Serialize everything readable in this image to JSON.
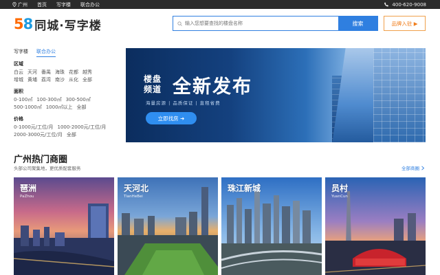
{
  "topbar": {
    "city": "广州",
    "links": [
      "首页",
      "写字楼",
      "联合办公"
    ],
    "phone": "400-620-9008"
  },
  "header": {
    "logo_number": "58",
    "logo_text": "同城·写字楼",
    "search_placeholder": "输入您想要查找的楼盘名称",
    "search_button": "搜索",
    "join_button": "品牌入驻 ▶"
  },
  "filters": {
    "tabs": [
      "写字楼",
      "联合办公"
    ],
    "active_tab": 1,
    "region": {
      "title": "区域",
      "rows": [
        [
          "白云",
          "天河",
          "番禺",
          "海珠",
          "花都",
          "越秀"
        ],
        [
          "增城",
          "黄埔",
          "荔湾",
          "南沙",
          "从化",
          "全部"
        ]
      ]
    },
    "area": {
      "title": "面积",
      "rows": [
        [
          "0-100㎡",
          "100-300㎡",
          "300-500㎡"
        ],
        [
          "500-1000㎡",
          "1000㎡以上",
          "全部"
        ]
      ]
    },
    "price": {
      "title": "价格",
      "rows": [
        [
          "0-1000元/工位/月",
          "1000-2000元/工位/月"
        ],
        [
          "2000-3000元/工位/月",
          "全部"
        ]
      ]
    }
  },
  "banner": {
    "label_line1": "楼盘",
    "label_line2": "频道",
    "headline": "全新发布",
    "tagline": "海量房源  |  品质保证  |  直租省费",
    "cta": "立即找房 ➜"
  },
  "hot": {
    "title": "广州热门商圈",
    "subtitle": "头部公司聚集地，更优质配套服务",
    "more": "全部商圈",
    "cards": [
      {
        "name": "琶洲",
        "pinyin": "PaZhou"
      },
      {
        "name": "天河北",
        "pinyin": "TianHeBei"
      },
      {
        "name": "珠江新城",
        "pinyin": ""
      },
      {
        "name": "员村",
        "pinyin": "YuanCun"
      }
    ]
  },
  "colors": {
    "accent": "#2f7fe0",
    "brand_orange": "#ff6a00",
    "topbar_bg": "#2b2b2b"
  }
}
